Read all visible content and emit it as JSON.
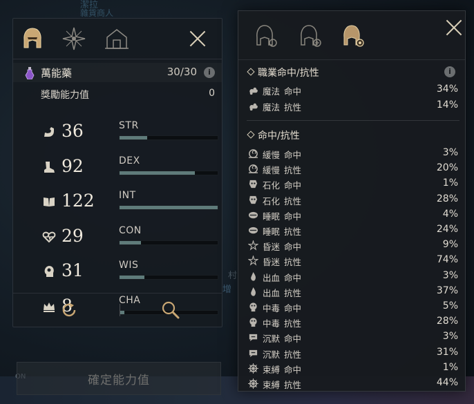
{
  "background": {
    "top_text_1": "潔拉",
    "top_text_2": "雜貨商人",
    "side_text": "村",
    "side_text_2": "增"
  },
  "left_panel": {
    "tabs": [
      "helmet-icon",
      "compass-icon",
      "house-icon"
    ],
    "potion": {
      "name": "萬能藥",
      "count": "30/30",
      "info": "i"
    },
    "bonus": {
      "label": "獎勵能力值",
      "value": "0"
    },
    "stats": [
      {
        "value": "36",
        "name": "STR",
        "icon": "arm-icon",
        "fill": 0.28
      },
      {
        "value": "92",
        "name": "DEX",
        "icon": "boot-icon",
        "fill": 0.77
      },
      {
        "value": "122",
        "name": "INT",
        "icon": "book-icon",
        "fill": 1.0
      },
      {
        "value": "29",
        "name": "CON",
        "icon": "heart-icon",
        "fill": 0.22
      },
      {
        "value": "31",
        "name": "WIS",
        "icon": "head-icon",
        "fill": 0.25
      },
      {
        "value": "8",
        "name": "CHA",
        "icon": "crown-icon",
        "fill": 0.05
      }
    ]
  },
  "confirm_button": {
    "label": "確定能力值",
    "badge": "ON"
  },
  "right_panel": {
    "tabs": [
      "helmet-gear-icon",
      "helmet-plus-icon",
      "helmet-active-icon"
    ],
    "class_section": {
      "title": "職業命中/抗性",
      "info": "i",
      "rows": [
        {
          "name": "魔法",
          "type": "命中",
          "value": "34%"
        },
        {
          "name": "魔法",
          "type": "抗性",
          "value": "14%"
        }
      ]
    },
    "hit_section": {
      "title": "命中/抗性",
      "rows": [
        {
          "name": "緩慢",
          "type": "命中",
          "value": "3%",
          "icon": "snail-icon"
        },
        {
          "name": "緩慢",
          "type": "抗性",
          "value": "20%",
          "icon": "snail-icon"
        },
        {
          "name": "石化",
          "type": "命中",
          "value": "1%",
          "icon": "stone-icon"
        },
        {
          "name": "石化",
          "type": "抗性",
          "value": "28%",
          "icon": "stone-icon"
        },
        {
          "name": "睡眠",
          "type": "命中",
          "value": "4%",
          "icon": "sleep-icon"
        },
        {
          "name": "睡眠",
          "type": "抗性",
          "value": "24%",
          "icon": "sleep-icon"
        },
        {
          "name": "昏迷",
          "type": "命中",
          "value": "9%",
          "icon": "stun-icon"
        },
        {
          "name": "昏迷",
          "type": "抗性",
          "value": "74%",
          "icon": "stun-icon"
        },
        {
          "name": "出血",
          "type": "命中",
          "value": "3%",
          "icon": "blood-icon"
        },
        {
          "name": "出血",
          "type": "抗性",
          "value": "37%",
          "icon": "blood-icon"
        },
        {
          "name": "中毒",
          "type": "命中",
          "value": "5%",
          "icon": "poison-icon"
        },
        {
          "name": "中毒",
          "type": "抗性",
          "value": "28%",
          "icon": "poison-icon"
        },
        {
          "name": "沉默",
          "type": "命中",
          "value": "3%",
          "icon": "silence-icon"
        },
        {
          "name": "沉默",
          "type": "抗性",
          "value": "31%",
          "icon": "silence-icon"
        },
        {
          "name": "束縛",
          "type": "命中",
          "value": "1%",
          "icon": "bind-icon"
        },
        {
          "name": "束縛",
          "type": "抗性",
          "value": "44%",
          "icon": "bind-icon"
        }
      ]
    }
  }
}
